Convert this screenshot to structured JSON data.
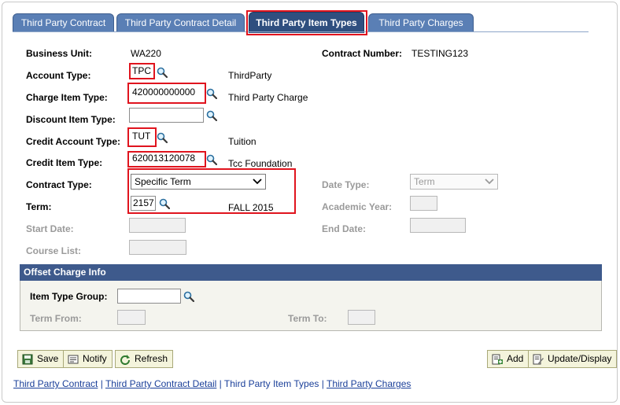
{
  "tabs": [
    {
      "label": "Third Party Contract"
    },
    {
      "label": "Third Party Contract Detail"
    },
    {
      "label": "Third Party Item Types"
    },
    {
      "label": "Third Party Charges"
    }
  ],
  "form": {
    "business_unit_label": "Business Unit:",
    "business_unit_value": "WA220",
    "contract_number_label": "Contract Number:",
    "contract_number_value": "TESTING123",
    "account_type_label": "Account Type:",
    "account_type_value": "TPC",
    "account_type_desc": "ThirdParty",
    "charge_item_type_label": "Charge Item Type:",
    "charge_item_type_value": "420000000000",
    "charge_item_type_desc": "Third Party Charge",
    "discount_item_type_label": "Discount Item Type:",
    "discount_item_type_value": "",
    "credit_account_type_label": "Credit Account Type:",
    "credit_account_type_value": "TUT",
    "credit_account_type_desc": "Tuition",
    "credit_item_type_label": "Credit Item Type:",
    "credit_item_type_value": "620013120078",
    "credit_item_type_desc": "Tcc Foundation",
    "contract_type_label": "Contract Type:",
    "contract_type_value": "Specific Term",
    "date_type_label": "Date Type:",
    "date_type_value": "Term",
    "term_label": "Term:",
    "term_value": "2157",
    "term_desc": "FALL 2015",
    "academic_year_label": "Academic Year:",
    "start_date_label": "Start Date:",
    "end_date_label": "End Date:",
    "course_list_label": "Course List:"
  },
  "offset": {
    "title": "Offset Charge Info",
    "item_type_group_label": "Item Type Group:",
    "term_from_label": "Term From:",
    "term_to_label": "Term To:"
  },
  "buttons": {
    "save": "Save",
    "notify": "Notify",
    "refresh": "Refresh",
    "add": "Add",
    "update_display": "Update/Display"
  },
  "footer_links": {
    "l1": "Third Party Contract",
    "sep": " | ",
    "l2": "Third Party Contract Detail",
    "l3": "Third Party Item Types",
    "l4": "Third Party Charges"
  },
  "colors": {
    "tab": "#5a7fb5",
    "tab_active": "#2f4f7f",
    "highlight": "#e0141e",
    "panel_header": "#3e5a8c"
  }
}
